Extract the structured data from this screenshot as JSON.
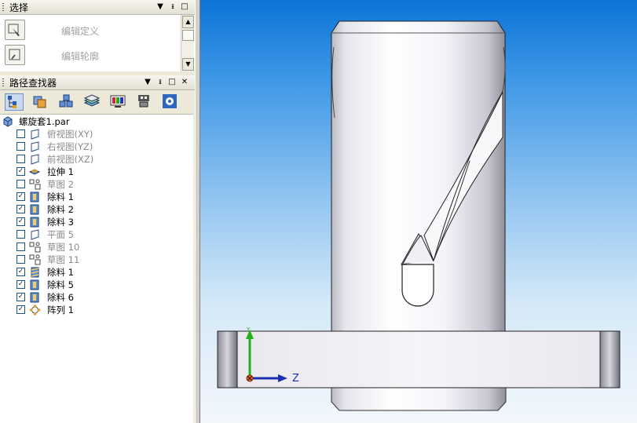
{
  "selection_pane": {
    "title": "选择",
    "items": [
      {
        "label": "编辑定义",
        "icon": "edit-definition-icon"
      },
      {
        "label": "编辑轮廓",
        "icon": "edit-profile-icon"
      }
    ]
  },
  "pathfinder": {
    "title": "路径查找器",
    "toolbar_icons": [
      "feature-tree-icon",
      "layers-icon",
      "assembly-icon",
      "stack-icon",
      "display-icon",
      "robot-icon",
      "settings-icon"
    ],
    "root": "螺旋套1.par",
    "items": [
      {
        "label": "俯视图(XY)",
        "checked": false,
        "dim": true,
        "icon": "plane-icon"
      },
      {
        "label": "右视图(YZ)",
        "checked": false,
        "dim": true,
        "icon": "plane-icon"
      },
      {
        "label": "前视图(XZ)",
        "checked": false,
        "dim": true,
        "icon": "plane-icon"
      },
      {
        "label": "拉伸 1",
        "checked": true,
        "dim": false,
        "icon": "extrude-icon"
      },
      {
        "label": "草图 2",
        "checked": false,
        "dim": true,
        "icon": "sketch-icon"
      },
      {
        "label": "除料 1",
        "checked": true,
        "dim": false,
        "icon": "cutout-icon"
      },
      {
        "label": "除料 2",
        "checked": true,
        "dim": false,
        "icon": "cutout-icon"
      },
      {
        "label": "除料 3",
        "checked": true,
        "dim": false,
        "icon": "cutout-icon"
      },
      {
        "label": "平面 5",
        "checked": false,
        "dim": true,
        "icon": "plane-icon"
      },
      {
        "label": "草图 10",
        "checked": false,
        "dim": true,
        "icon": "sketch-icon"
      },
      {
        "label": "草图 11",
        "checked": false,
        "dim": true,
        "icon": "sketch-icon"
      },
      {
        "label": "除料 1",
        "checked": true,
        "dim": false,
        "icon": "helical-cutout-icon"
      },
      {
        "label": "除料 5",
        "checked": true,
        "dim": false,
        "icon": "cutout-icon"
      },
      {
        "label": "除料 6",
        "checked": true,
        "dim": false,
        "icon": "cutout-icon"
      },
      {
        "label": "阵列 1",
        "checked": true,
        "dim": false,
        "icon": "pattern-icon"
      }
    ]
  },
  "viewport": {
    "axis_z_label": "Z",
    "axis_y_label": "Y"
  },
  "colors": {
    "accent": "#1d2fb0",
    "sky_top": "#0b74d6",
    "sky_bottom": "#f2f7fc"
  }
}
